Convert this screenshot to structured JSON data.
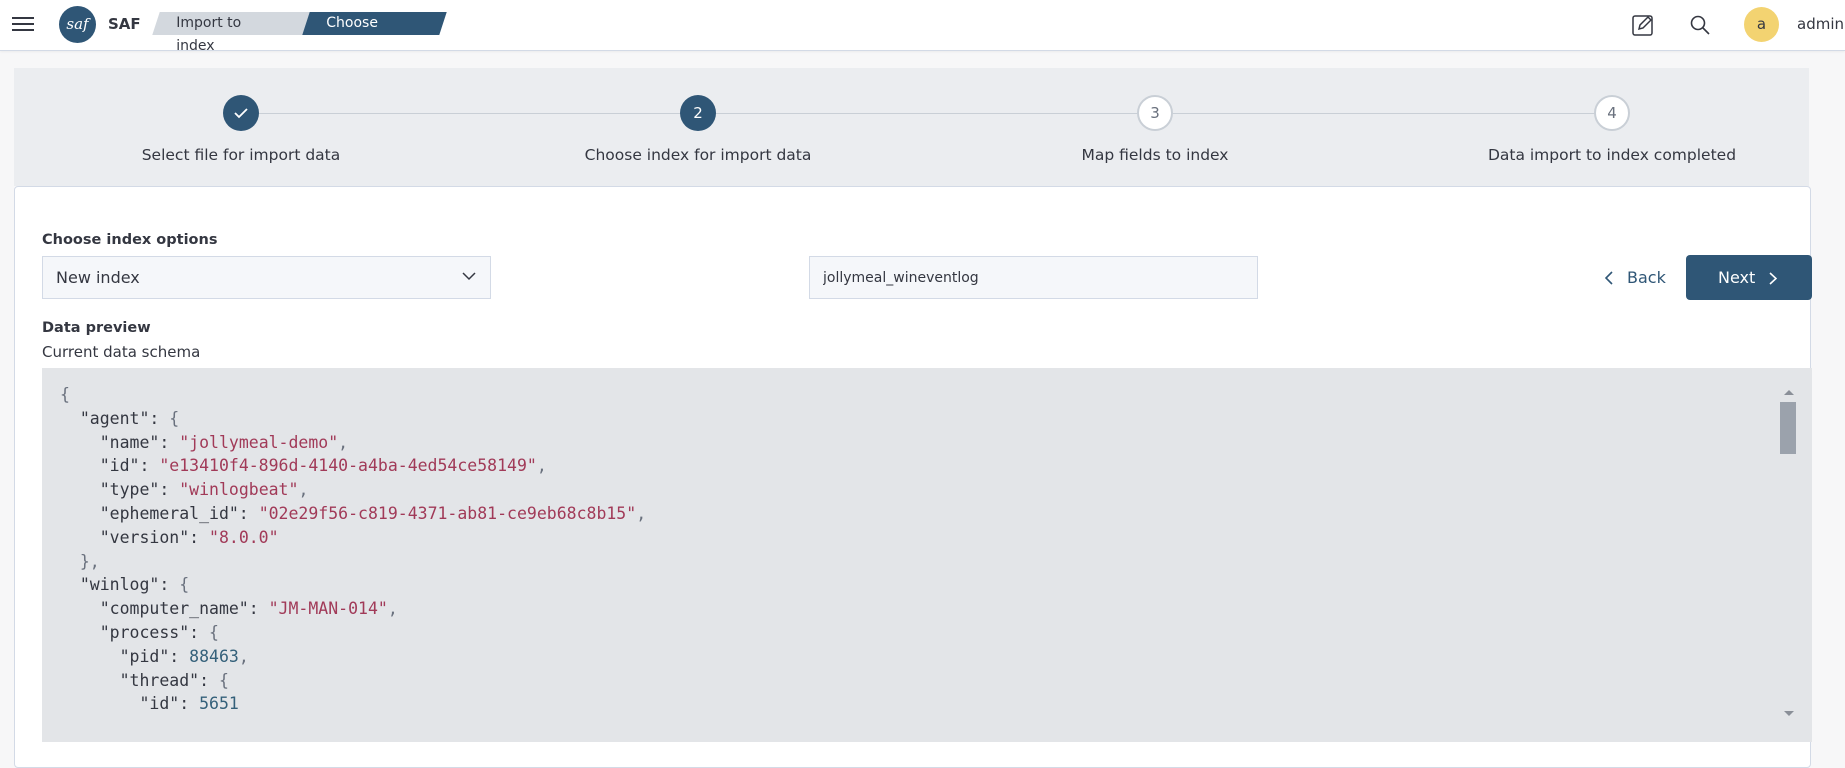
{
  "header": {
    "brand": "SAF",
    "logo_text": "saf",
    "breadcrumbs": [
      "Import to index",
      "Choose index"
    ],
    "user_initial": "a",
    "username": "admin",
    "icons": [
      "menu-icon",
      "edit-icon",
      "search-icon"
    ]
  },
  "steps": [
    {
      "label": "Select file for import data",
      "status": "complete",
      "marker": "check-icon"
    },
    {
      "label": "Choose index for import data",
      "status": "current",
      "marker": "2"
    },
    {
      "label": "Map fields to index",
      "status": "incomplete",
      "marker": "3"
    },
    {
      "label": "Data import to index completed",
      "status": "incomplete",
      "marker": "4"
    }
  ],
  "form": {
    "index_options_label": "Choose index options",
    "index_option_selected": "New index",
    "index_name_value": "jollymeal_wineventlog",
    "back_label": "Back",
    "next_label": "Next"
  },
  "preview": {
    "title": "Data preview",
    "subtitle": "Current data schema",
    "lines": [
      [
        [
          "p",
          "{"
        ]
      ],
      [
        [
          "k",
          "  \"agent\": "
        ],
        [
          "p",
          "{"
        ]
      ],
      [
        [
          "k",
          "    \"name\": "
        ],
        [
          "s",
          "\"jollymeal-demo\""
        ],
        [
          "p",
          ","
        ]
      ],
      [
        [
          "k",
          "    \"id\": "
        ],
        [
          "s",
          "\"e13410f4-896d-4140-a4ba-4ed54ce58149\""
        ],
        [
          "p",
          ","
        ]
      ],
      [
        [
          "k",
          "    \"type\": "
        ],
        [
          "s",
          "\"winlogbeat\""
        ],
        [
          "p",
          ","
        ]
      ],
      [
        [
          "k",
          "    \"ephemeral_id\": "
        ],
        [
          "s",
          "\"02e29f56-c819-4371-ab81-ce9eb68c8b15\""
        ],
        [
          "p",
          ","
        ]
      ],
      [
        [
          "k",
          "    \"version\": "
        ],
        [
          "s",
          "\"8.0.0\""
        ]
      ],
      [
        [
          "p",
          "  },"
        ]
      ],
      [
        [
          "k",
          "  \"winlog\": "
        ],
        [
          "p",
          "{"
        ]
      ],
      [
        [
          "k",
          "    \"computer_name\": "
        ],
        [
          "s",
          "\"JM-MAN-014\""
        ],
        [
          "p",
          ","
        ]
      ],
      [
        [
          "k",
          "    \"process\": "
        ],
        [
          "p",
          "{"
        ]
      ],
      [
        [
          "k",
          "      \"pid\": "
        ],
        [
          "n",
          "88463"
        ],
        [
          "p",
          ","
        ]
      ],
      [
        [
          "k",
          "      \"thread\": "
        ],
        [
          "p",
          "{"
        ]
      ],
      [
        [
          "k",
          "        \"id\": "
        ],
        [
          "n",
          "5651"
        ]
      ]
    ]
  },
  "colors": {
    "primary": "#2f5676",
    "avatar": "#f3d371",
    "string_value": "#a13a58",
    "number_value": "#34607a"
  }
}
